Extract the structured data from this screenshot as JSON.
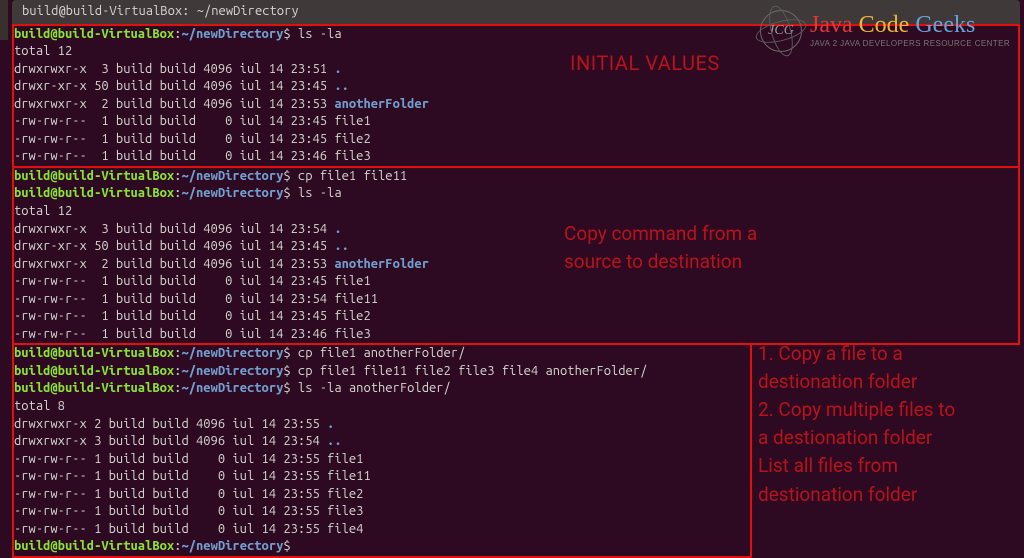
{
  "titlebar": "build@build-VirtualBox: ~/newDirectory",
  "prompt": {
    "user": "build@build-VirtualBox",
    "sep1": ":",
    "path": "~/newDirectory",
    "sep2": "$"
  },
  "annotations": {
    "a1": "INITIAL VALUES",
    "a2_l1": "Copy command from a",
    "a2_l2": "source to destination",
    "a3_l1": "1. Copy a file to a",
    "a3_l2": "destionation folder",
    "a3_l3": "2. Copy multiple files to",
    "a3_l4": "a destionation folder",
    "a3_l5": "List all files from",
    "a3_l6": "destionation folder"
  },
  "logo": {
    "badge": "JCG",
    "w1": "Java",
    "w2": "Code",
    "w3": "Geeks",
    "tag": "JAVA 2 JAVA DEVELOPERS RESOURCE CENTER"
  },
  "s1": {
    "cmd1": " ls -la",
    "total": "total 12",
    "l1a": "drwxrwxr-x  3 build build 4096 iul 14 23:51 ",
    "l1b": ".",
    "l2a": "drwxr-xr-x 50 build build 4096 iul 14 23:45 ",
    "l2b": "..",
    "l3a": "drwxrwxr-x  2 build build 4096 iul 14 23:53 ",
    "l3b": "anotherFolder",
    "l4": "-rw-rw-r--  1 build build    0 iul 14 23:45 file1",
    "l5": "-rw-rw-r--  1 build build    0 iul 14 23:45 file2",
    "l6": "-rw-rw-r--  1 build build    0 iul 14 23:46 file3"
  },
  "s2": {
    "cmd1": " cp file1 file11",
    "cmd2": " ls -la",
    "total": "total 12",
    "l1a": "drwxrwxr-x  3 build build 4096 iul 14 23:54 ",
    "l1b": ".",
    "l2a": "drwxr-xr-x 50 build build 4096 iul 14 23:45 ",
    "l2b": "..",
    "l3a": "drwxrwxr-x  2 build build 4096 iul 14 23:53 ",
    "l3b": "anotherFolder",
    "l4": "-rw-rw-r--  1 build build    0 iul 14 23:45 file1",
    "l5": "-rw-rw-r--  1 build build    0 iul 14 23:54 file11",
    "l6": "-rw-rw-r--  1 build build    0 iul 14 23:45 file2",
    "l7": "-rw-rw-r--  1 build build    0 iul 14 23:46 file3"
  },
  "s3": {
    "cmd1": " cp file1 anotherFolder/",
    "cmd2": " cp file1 file11 file2 file3 file4 anotherFolder/",
    "cmd3": " ls -la anotherFolder/",
    "total": "total 8",
    "l1a": "drwxrwxr-x 2 build build 4096 iul 14 23:55 ",
    "l1b": ".",
    "l2a": "drwxrwxr-x 3 build build 4096 iul 14 23:54 ",
    "l2b": "..",
    "l3": "-rw-rw-r-- 1 build build    0 iul 14 23:55 file1",
    "l4": "-rw-rw-r-- 1 build build    0 iul 14 23:55 file11",
    "l5": "-rw-rw-r-- 1 build build    0 iul 14 23:55 file2",
    "l6": "-rw-rw-r-- 1 build build    0 iul 14 23:55 file3",
    "l7": "-rw-rw-r-- 1 build build    0 iul 14 23:55 file4",
    "cmd4": " "
  }
}
